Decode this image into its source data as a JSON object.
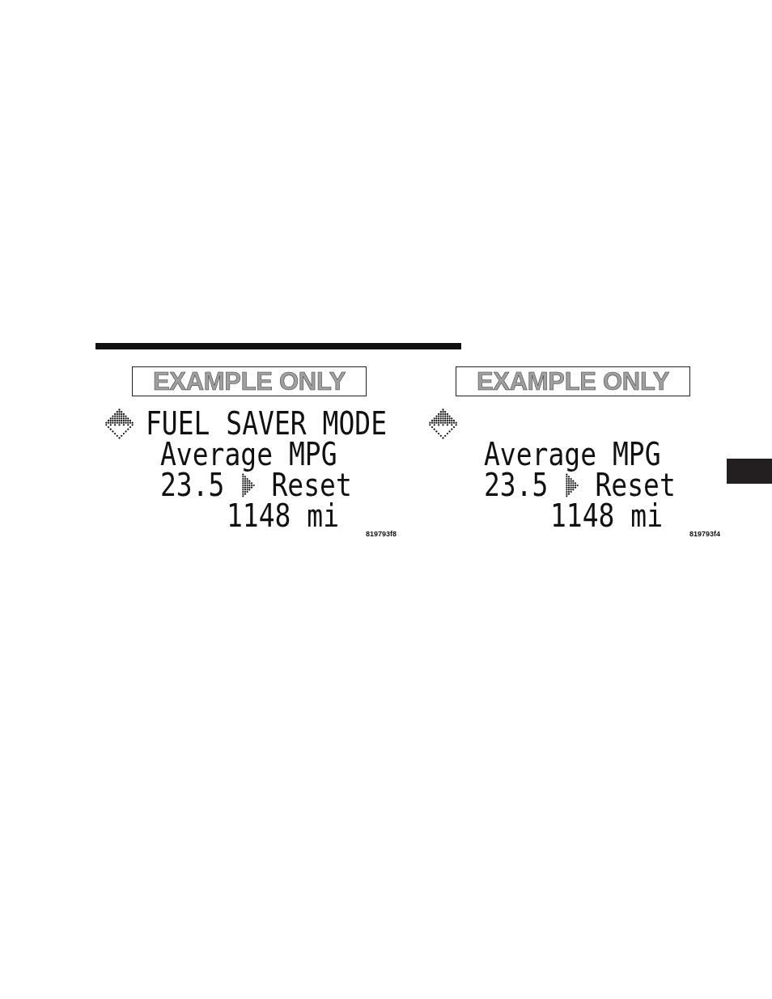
{
  "figures": [
    {
      "stamp": "EXAMPLE ONLY",
      "title": "FUEL SAVER MODE",
      "label": "Average MPG",
      "value": "23.5",
      "action": "Reset",
      "distance": "1148 mi",
      "code": "819793f8"
    },
    {
      "stamp": "EXAMPLE ONLY",
      "label": "Average MPG",
      "value": "23.5",
      "action": "Reset",
      "distance": "1148 mi",
      "code": "819793f4"
    }
  ]
}
